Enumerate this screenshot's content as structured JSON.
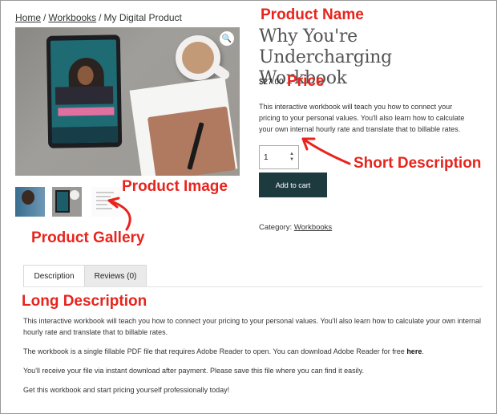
{
  "breadcrumb": {
    "home": "Home",
    "category": "Workbooks",
    "current": "My Digital Product",
    "separator": "/"
  },
  "image": {
    "zoom_icon": "magnifier-icon",
    "zoom_glyph": "🔍"
  },
  "product": {
    "title": "Why You're Undercharging Workbook",
    "price": "$27.00",
    "short_description": "This interactive workbook will teach you how to connect your pricing to your personal values. You'll also learn how to calculate your own internal hourly rate and translate that to billable rates.",
    "quantity": "1",
    "add_to_cart_label": "Add to cart",
    "category_label": "Category:",
    "category_link": "Workbooks"
  },
  "tabs": [
    {
      "label": "Description",
      "active": true
    },
    {
      "label": "Reviews (0)",
      "active": false
    }
  ],
  "long_description": {
    "p1": "This interactive workbook will teach you how to connect your pricing to your personal values. You'll also learn how to calculate your own internal hourly rate and translate that to billable rates.",
    "p2_before": "The workbook is a single fillable PDF file that requires Adobe Reader to open. You can download Adobe Reader for free ",
    "p2_link": "here",
    "p2_after": ".",
    "p3": "You'll receive your file via instant download after payment. Please save this file where you can find it easily.",
    "p4": "Get this workbook and start pricing yourself professionally today!"
  },
  "annotations": {
    "product_name": "Product Name",
    "price": "Price",
    "short_description": "Short Description",
    "product_image": "Product Image",
    "product_gallery": "Product Gallery",
    "long_description": "Long Description",
    "color": "#e8241d"
  }
}
